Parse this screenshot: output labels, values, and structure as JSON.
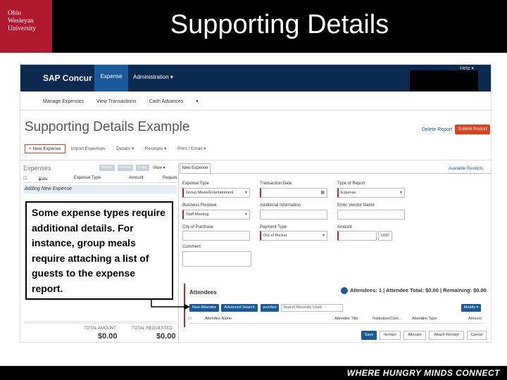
{
  "slide": {
    "logo_lines": [
      "Ohio",
      "Wesleyan",
      "University"
    ],
    "title": "Supporting Details",
    "tagline": "WHERE HUNGRY MINDS CONNECT"
  },
  "navbar": {
    "brand": "SAP Concur",
    "brand_mark": "C",
    "expense_tab": "Expense",
    "administration": "Administration",
    "help": "Help"
  },
  "subnav": {
    "items": [
      "Manage Expenses",
      "View Transactions",
      "Cash Advances"
    ]
  },
  "report": {
    "title": "Supporting Details Example",
    "delete_label": "Delete Report",
    "submit_label": "Submit Report"
  },
  "actions": {
    "new_expense": "New Expense",
    "items": [
      "Import Expenses",
      "Details",
      "Receipts",
      "Print / Email"
    ]
  },
  "expenses_pane": {
    "header": "Expenses",
    "buttons": [
      "Move",
      "Delete",
      "Copy"
    ],
    "view_label": "View",
    "columns": [
      "Date",
      "Expense Type",
      "Amount",
      "Reques"
    ],
    "adding_row": "Adding New Expense",
    "total_amount_label": "TOTAL AMOUNT",
    "total_amount": "$0.00",
    "total_requested_label": "TOTAL REQUESTED",
    "total_requested": "$0.00"
  },
  "form": {
    "tab": "New Expense",
    "available_receipts": "Available Receipts",
    "expense_type_label": "Expense Type",
    "expense_type_value": "Group Meals/Entertainment",
    "transaction_date_label": "Transaction Date",
    "type_of_report_label": "Type of Report",
    "type_of_report_value": "Expense",
    "business_purpose_label": "Business Purpose",
    "business_purpose_value": "Staff Meeting",
    "additional_info_label": "Additional Information",
    "vendor_label": "Enter Vendor Name",
    "city_label": "City of Purchase",
    "payment_type_label": "Payment Type",
    "payment_type_value": "Out of Pocket",
    "amount_label": "Amount",
    "currency_value": "USD",
    "comment_label": "Comment"
  },
  "attendees": {
    "title": "Attendees",
    "summary": "Attendees: 1 | Attendee Total: $0.00 | Remaining: $0.00",
    "buttons": [
      "New Attendee",
      "Advanced Search",
      "avorites"
    ],
    "search_placeholder": "Search Recently Used",
    "modify": "Modify",
    "columns": [
      "Attendee Name",
      "Attendee Title",
      "Institution/Com...",
      "Attendee Type",
      "Amount"
    ]
  },
  "footer_buttons": [
    "Save",
    "Itemize",
    "Allocate",
    "Attach Receipt",
    "Cancel"
  ],
  "callout": {
    "text": "Some expense types require additional details. For instance, group meals require attaching a list of guests to the expense report."
  },
  "colors": {
    "brand_red": "#b0192e",
    "nav_blue": "#0a2a4f",
    "accent_orange": "#d9431f",
    "button_blue": "#1a5a9a"
  }
}
